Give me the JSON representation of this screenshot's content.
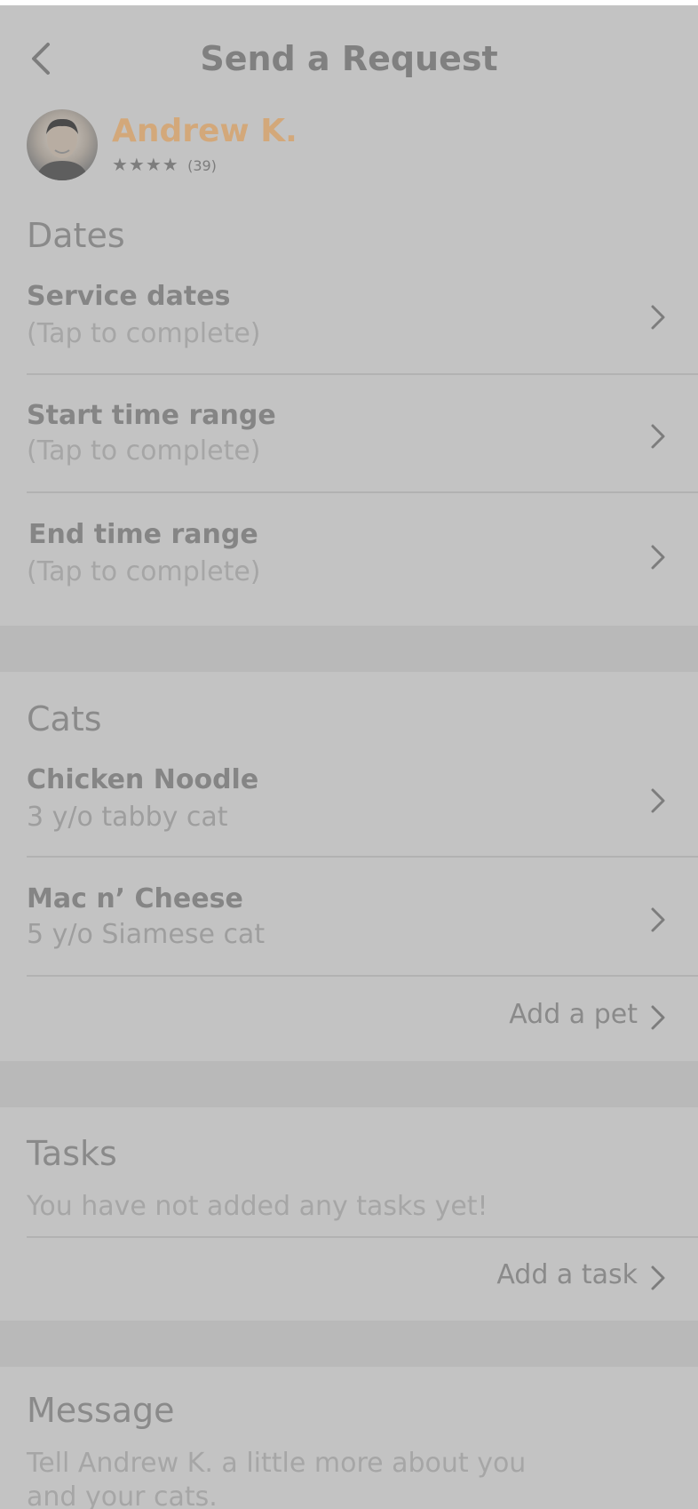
{
  "header": {
    "title": "Send a Request"
  },
  "sitter": {
    "name": "Andrew K.",
    "stars": "★★★★",
    "review_count": "(39)"
  },
  "dates": {
    "title": "Dates",
    "rows": [
      {
        "label": "Service dates",
        "value": "(Tap to complete)"
      },
      {
        "label": "Start time range",
        "value": "(Tap to complete)"
      },
      {
        "label": "End time range",
        "value": "(Tap to complete)"
      }
    ]
  },
  "cats": {
    "title": "Cats",
    "pets": [
      {
        "name": "Chicken Noodle",
        "desc": "3 y/o tabby cat"
      },
      {
        "name": "Mac n’ Cheese",
        "desc": "5 y/o Siamese cat"
      }
    ],
    "add_label": "Add a pet"
  },
  "tasks": {
    "title": "Tasks",
    "empty_text": "You have not added any tasks yet!",
    "add_label": "Add a task"
  },
  "message": {
    "title": "Message",
    "placeholder": "Tell Andrew K. a little more about you and your cats."
  },
  "colors": {
    "overlay_bg": "#c3c3c3",
    "accent_name": "#d3a87a",
    "text_primary": "#858585",
    "text_placeholder": "#a6a6a6"
  },
  "icons": [
    "back-chevron-icon",
    "chevron-right-icon",
    "star-icon"
  ]
}
